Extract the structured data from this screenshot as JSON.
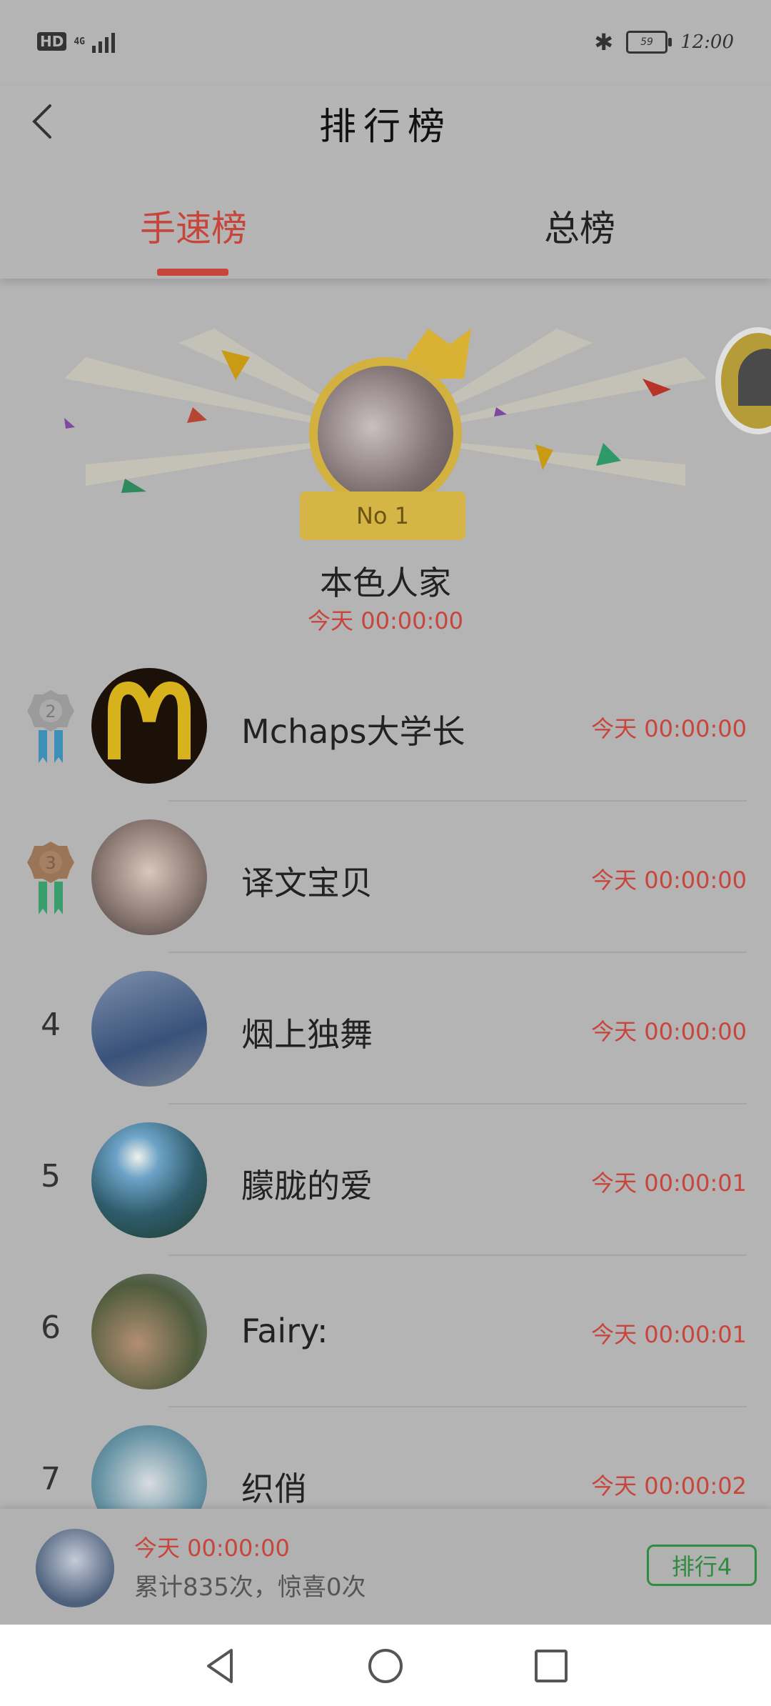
{
  "status_bar": {
    "left": {
      "hd": "HD",
      "network": "4G"
    },
    "right": {
      "battery": "59",
      "time": "12:00"
    }
  },
  "header": {
    "title": "排行榜",
    "tabs": [
      {
        "label": "手速榜",
        "active": true
      },
      {
        "label": "总榜",
        "active": false
      }
    ]
  },
  "champion": {
    "badge": "No 1",
    "name": "本色人家",
    "time": "今天 00:00:00"
  },
  "ranking": [
    {
      "rank": "2",
      "name": "Mchaps大学长",
      "time": "今天 00:00:00",
      "medal": "silver"
    },
    {
      "rank": "3",
      "name": "译文宝贝",
      "time": "今天 00:00:00",
      "medal": "bronze"
    },
    {
      "rank": "4",
      "name": "烟上独舞",
      "time": "今天 00:00:00"
    },
    {
      "rank": "5",
      "name": "朦胧的爱",
      "time": "今天 00:00:01"
    },
    {
      "rank": "6",
      "name": "Fairy:",
      "time": "今天 00:00:01"
    },
    {
      "rank": "7",
      "name": "织俏",
      "time": "今天 00:00:02"
    }
  ],
  "my_record": {
    "time": "今天 00:00:00",
    "stats": "累计835次，惊喜0次",
    "rank_button": "排行4"
  },
  "colors": {
    "accent": "#c8453c",
    "rank_button": "#2f8b3f"
  }
}
